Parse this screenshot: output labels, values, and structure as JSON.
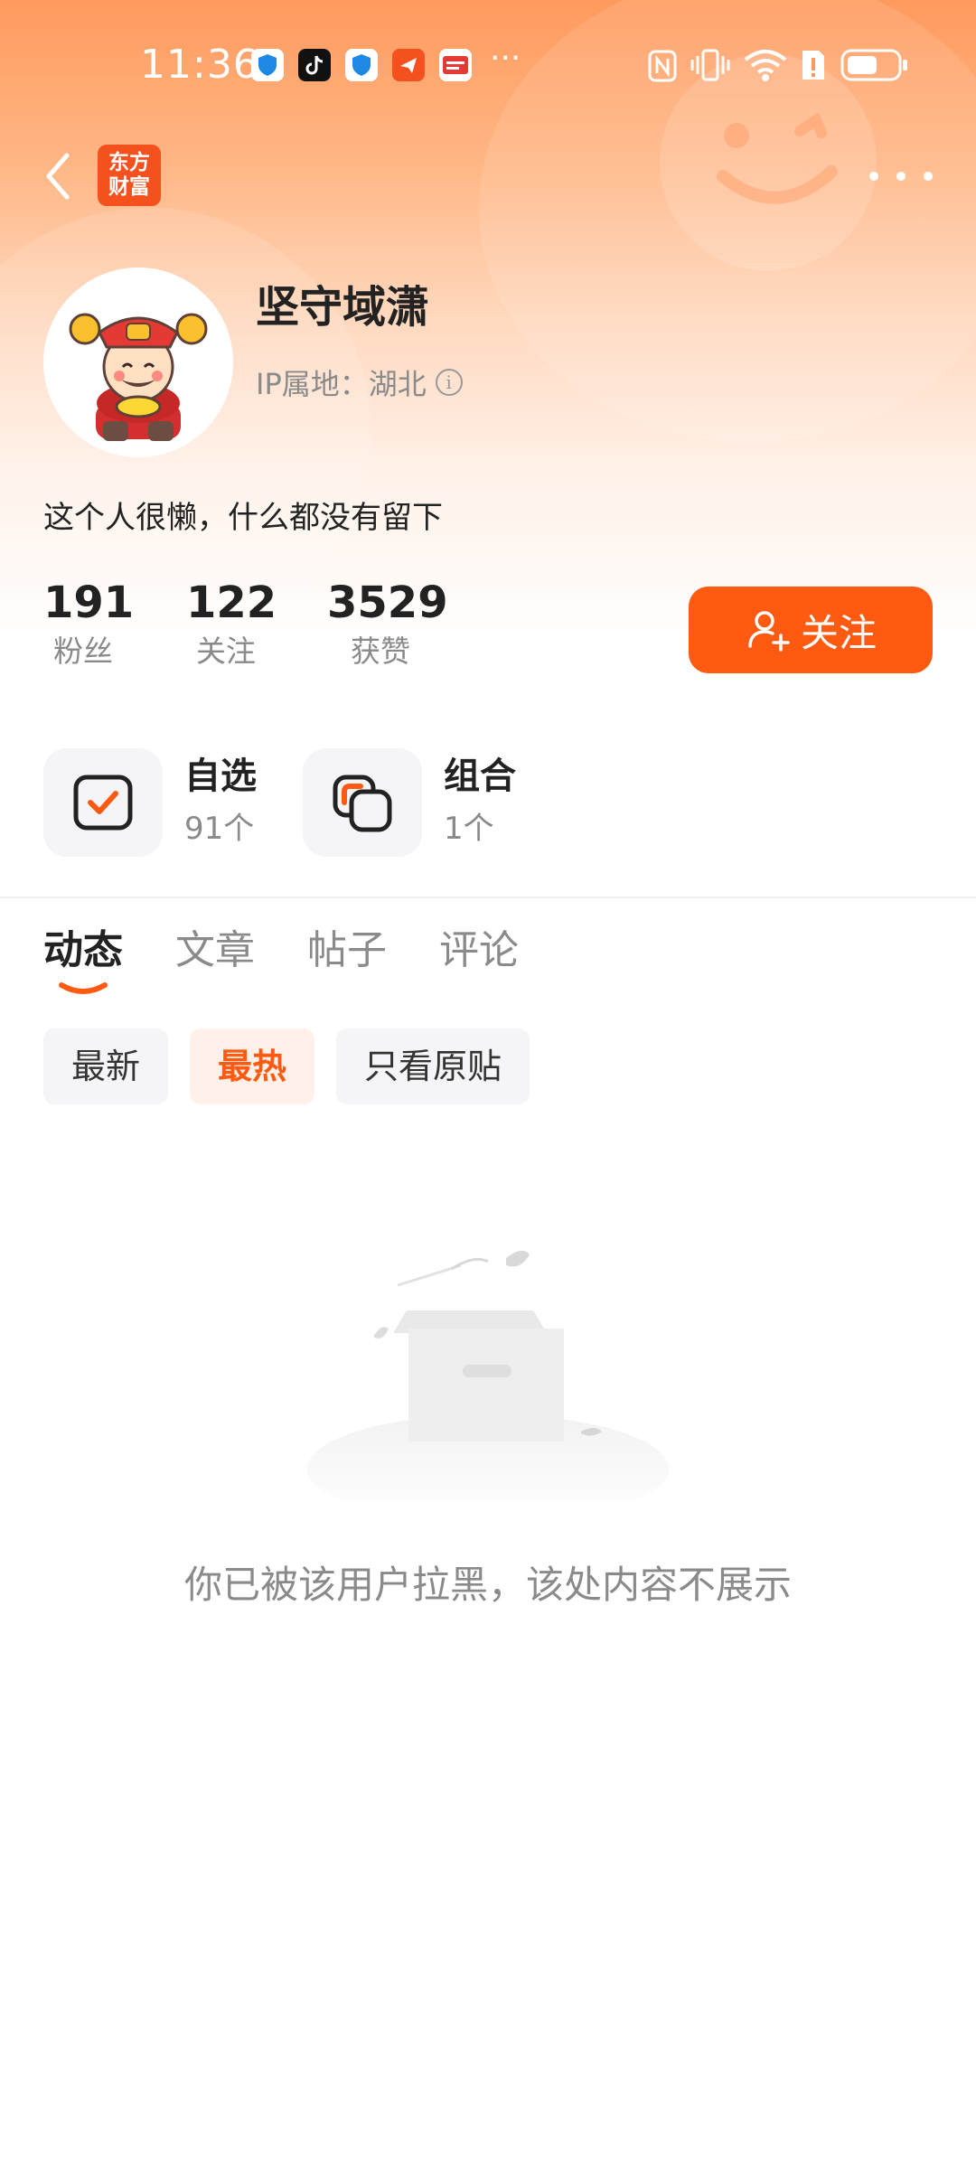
{
  "status_bar": {
    "time": "11:36",
    "more": "···"
  },
  "nav": {
    "logo_line1": "东方",
    "logo_line2": "财富"
  },
  "profile": {
    "name": "坚守域潇",
    "ip_location": "IP属地：湖北",
    "bio": "这个人很懒，什么都没有留下"
  },
  "stats": [
    {
      "value": "191",
      "label": "粉丝"
    },
    {
      "value": "122",
      "label": "关注"
    },
    {
      "value": "3529",
      "label": "获赞"
    }
  ],
  "follow_button": "关注",
  "quick_links": [
    {
      "title": "自选",
      "count": "91个",
      "icon": "checkbox-icon"
    },
    {
      "title": "组合",
      "count": "1个",
      "icon": "portfolio-icon"
    }
  ],
  "tabs": [
    "动态",
    "文章",
    "帖子",
    "评论"
  ],
  "active_tab": 0,
  "filters": [
    "最新",
    "最热",
    "只看原贴"
  ],
  "active_filter": 1,
  "empty_message": "你已被该用户拉黑，该处内容不展示",
  "colors": {
    "accent": "#ff5a12",
    "header_gradient_top": "#ff9a5e"
  }
}
